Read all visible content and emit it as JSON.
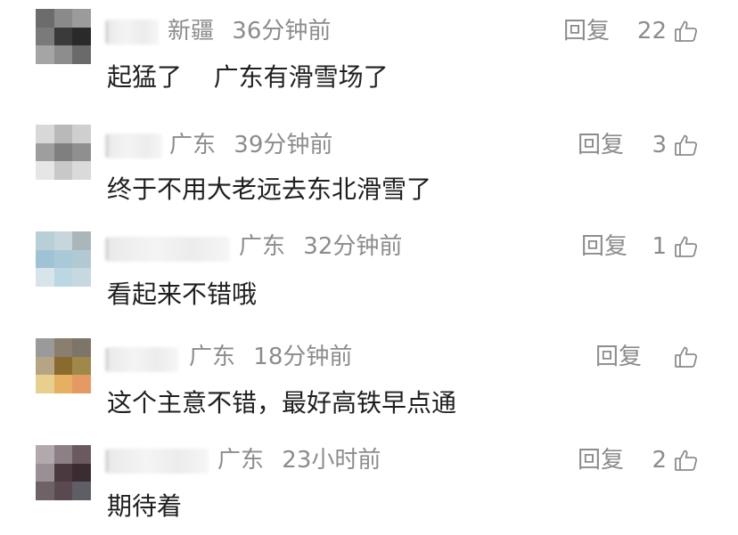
{
  "comments": [
    {
      "location": "新疆",
      "time": "36分钟前",
      "reply_label": "回复",
      "likes": "22",
      "text": "起猛了    广东有滑雪场了",
      "avatar_colors": [
        "#6c6c6c",
        "#8a8a8a",
        "#9b9b9b",
        "#7a7a7a",
        "#3a3a3a",
        "#2a2a2a",
        "#a5a5a5",
        "#8d8d8d",
        "#6a6a6a"
      ]
    },
    {
      "location": "广东",
      "time": "39分钟前",
      "reply_label": "回复",
      "likes": "3",
      "text": "终于不用大老远去东北滑雪了",
      "avatar_colors": [
        "#d8d8d8",
        "#b9b9b9",
        "#cfcfcf",
        "#9e9e9e",
        "#7f7f7f",
        "#8f8f8f",
        "#e6e6e6",
        "#c8c8c8",
        "#dadada"
      ]
    },
    {
      "location": "广东",
      "time": "32分钟前",
      "reply_label": "回复",
      "likes": "1",
      "text": "看起来不错哦",
      "avatar_colors": [
        "#b8cfd8",
        "#c7d5dc",
        "#aab6ba",
        "#9fc3d4",
        "#a9c9d8",
        "#b2c9d3",
        "#d7e4ea",
        "#bcd7e4",
        "#c6d8e0"
      ]
    },
    {
      "location": "广东",
      "time": "18分钟前",
      "reply_label": "回复",
      "likes": "",
      "text": "这个主意不错，最好高铁早点通",
      "avatar_colors": [
        "#9a9a9a",
        "#8a7f6e",
        "#7d756a",
        "#b5a585",
        "#8a6a2e",
        "#a08848",
        "#e7cf8f",
        "#e6b062",
        "#e59a64"
      ]
    },
    {
      "location": "广东",
      "time": "23小时前",
      "reply_label": "回复",
      "likes": "2",
      "text": "期待着",
      "avatar_colors": [
        "#b2a9ad",
        "#8c7f86",
        "#6a5a60",
        "#9a8f94",
        "#4a3a3f",
        "#3a2c30",
        "#6e6266",
        "#5a4a50",
        "#5e5e66"
      ]
    }
  ],
  "colors": {
    "meta_text": "#8c8c8c",
    "body_text": "#1f1f1f",
    "background": "#ffffff"
  },
  "icons": {
    "like": "thumbs-up-outline"
  }
}
